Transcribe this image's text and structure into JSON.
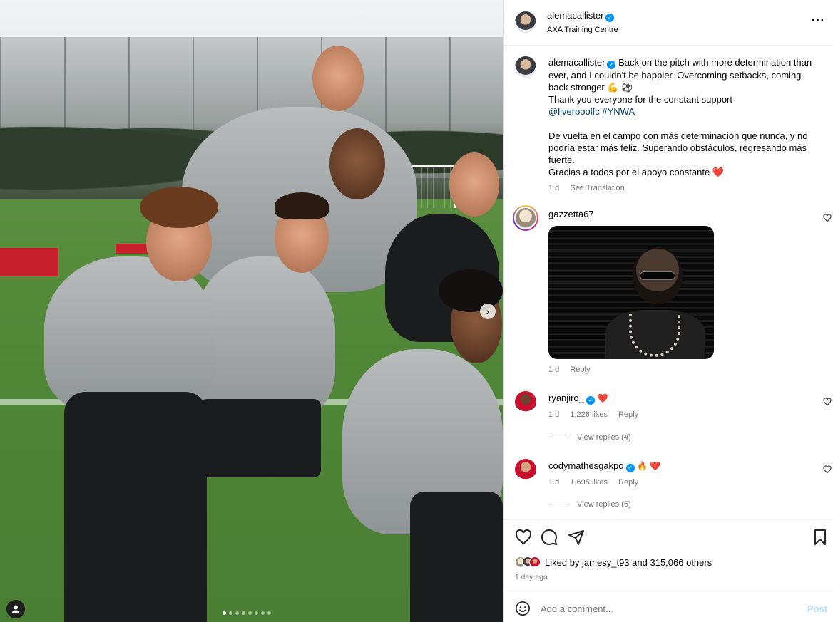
{
  "post": {
    "author": "alemacallister",
    "location": "AXA Training Centre",
    "media": {
      "current_slide": 1,
      "total_slides": 10,
      "next_icon": "chevron-right-icon",
      "tag_icon": "user-tag-icon"
    }
  },
  "caption": {
    "username": "alemacallister",
    "line1": "Back on the pitch with more determination than ever, and I couldn't be happier. Overcoming setbacks, coming back stronger 💪 ⚽",
    "line2": "Thank you everyone for the constant support",
    "mentions": "@liverpoolfc #YNWA",
    "line3": "De vuelta en el campo con más determinación que nunca, y no podría estar más feliz. Superando obstáculos, regresando más fuerte.",
    "line4": "Gracias a todos por el apoyo constante ❤️",
    "time": "1 d",
    "see_translation": "See Translation"
  },
  "comments": [
    {
      "username": "gazzetta67",
      "verified": false,
      "text": "",
      "has_gif": true,
      "time": "1 d",
      "likes": "",
      "reply_label": "Reply",
      "view_replies": ""
    },
    {
      "username": "ryanjiro_",
      "verified": true,
      "text": "❤️",
      "has_gif": false,
      "time": "1 d",
      "likes": "1,226 likes",
      "reply_label": "Reply",
      "view_replies": "View replies (4)"
    },
    {
      "username": "codymathesgakpo",
      "verified": true,
      "text": "🔥 ❤️",
      "has_gif": false,
      "time": "1 d",
      "likes": "1,695 likes",
      "reply_label": "Reply",
      "view_replies": "View replies (5)"
    }
  ],
  "actions": {
    "like_icon": "heart-icon",
    "comment_icon": "comment-icon",
    "share_icon": "share-icon",
    "save_icon": "bookmark-icon"
  },
  "likes": {
    "prefix": "Liked by",
    "user": "jamesy_t93",
    "conj": "and",
    "others": "315,066 others"
  },
  "timestamp": "1 day ago",
  "composer": {
    "placeholder": "Add a comment...",
    "post_label": "Post",
    "emoji_icon": "smiley-icon"
  },
  "colors": {
    "verified": "#0095f6",
    "link": "#00376b",
    "secondary_text": "#737373",
    "post_disabled": "#b2dffc"
  }
}
